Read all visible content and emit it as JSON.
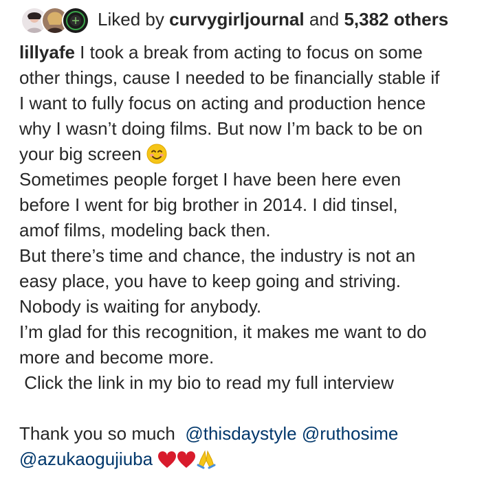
{
  "likes": {
    "prefix": "Liked by",
    "first_user": "curvygirljournal",
    "and": "and",
    "count": "5,382 others"
  },
  "caption": {
    "username": "lillyafe",
    "line1": " I took a break from acting to focus on some",
    "line2": "other things, cause I needed to be financially stable if",
    "line3": "I want to fully focus on acting and production hence",
    "line4": "why I wasn’t doing films. But now I’m back to be on",
    "line5": "your big screen ",
    "line6": "Sometimes people forget I have been here even",
    "line7": "before I went for big brother in 2014. I did tinsel,",
    "line8": "amof films, modeling back then.",
    "line9": "But there’s time and chance, the industry is not an",
    "line10": "easy place, you have to keep going and striving.",
    "line11": "Nobody is waiting for anybody.",
    "line12": "I’m glad for this recognition, it makes me want to do",
    "line13": "more and become more.",
    "line14": " Click the link in my bio to read my full interview",
    "line16": "Thank you so much  ",
    "mention1": "@thisdaystyle",
    "mention2": "@ruthosime",
    "mention3": "@azukaogujiuba"
  },
  "icons": {
    "emoji_smile": "smiling-face-emoji",
    "emoji_heart": "red-heart-emoji",
    "emoji_pray": "folded-hands-emoji"
  },
  "colors": {
    "text": "#262626",
    "mention": "#00376b",
    "heart": "#d81b2c",
    "smile": "#f5c518"
  }
}
